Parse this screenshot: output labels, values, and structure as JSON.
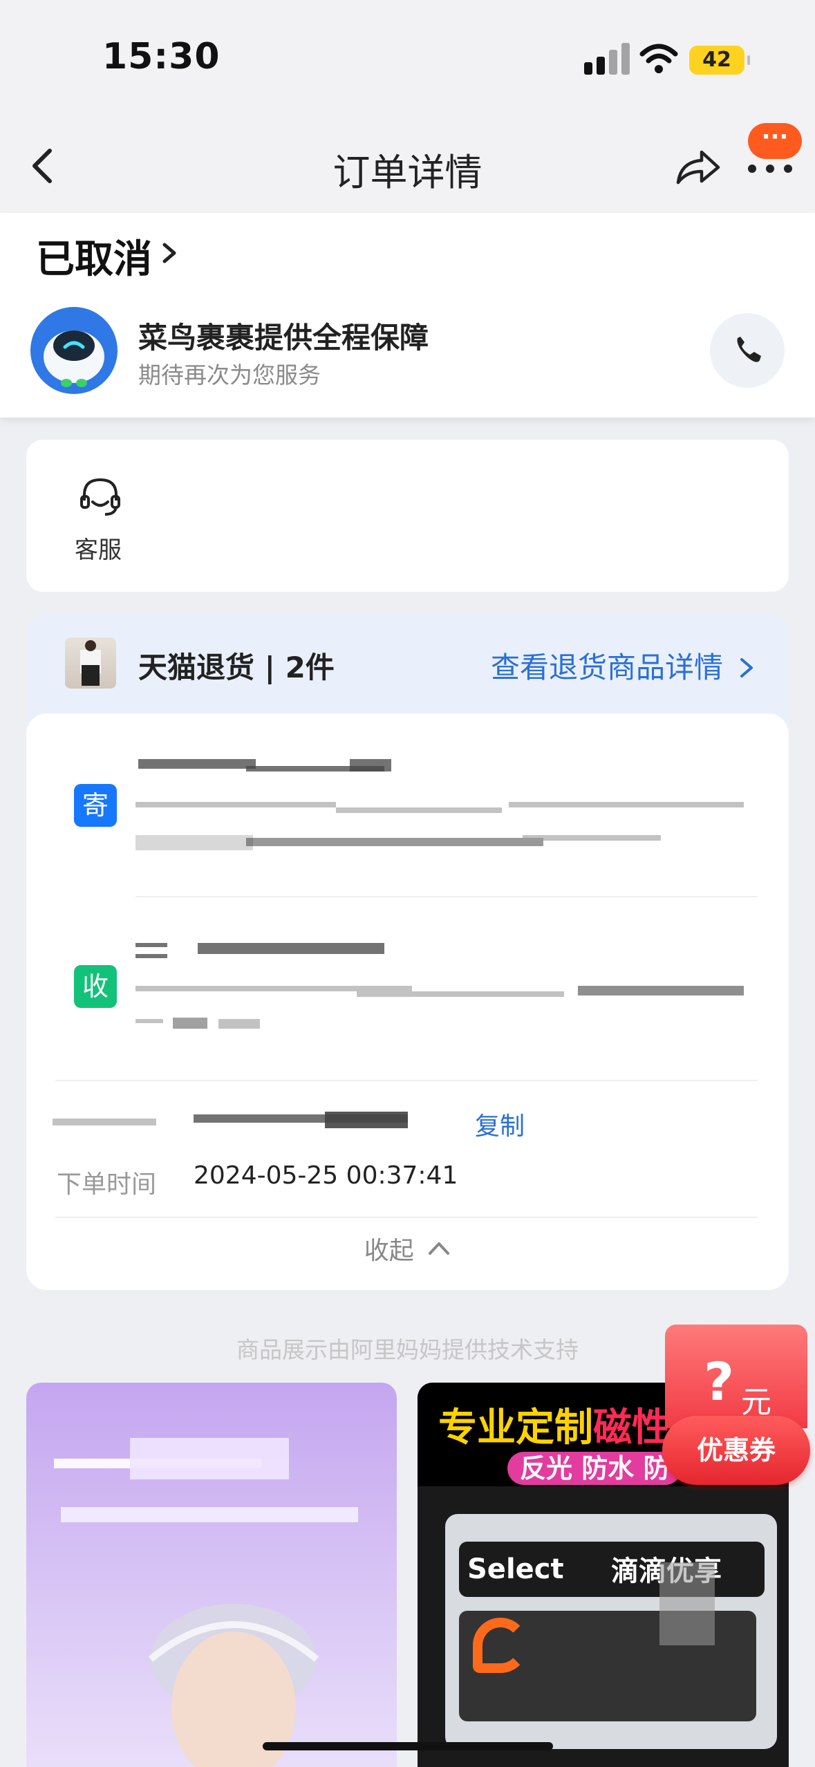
{
  "status_bar": {
    "time": "15:30",
    "battery": "42"
  },
  "nav": {
    "title": "订单详情",
    "badge": "···"
  },
  "order_status": {
    "title": "已取消",
    "courier_title": "菜鸟裹裹提供全程保障",
    "courier_subtitle": "期待再次为您服务"
  },
  "service": {
    "label": "客服"
  },
  "return_section": {
    "title": "天猫退货 | 2件",
    "details_link": "查看退货商品详情",
    "send_tag": "寄",
    "receive_tag": "收",
    "copy_label": "复制",
    "order_time_label": "下单时间",
    "order_time_value": "2024-05-25 00:37:41",
    "collapse_label": "收起"
  },
  "footer_note": "商品展示由阿里妈妈提供技术支持",
  "products": {
    "p2_title_a": "专业定制",
    "p2_title_b": "磁性",
    "p2_tags": "反光 防水 防",
    "p2_plate_text": "Select",
    "p2_brand": "滴滴优享"
  },
  "coupon": {
    "amount": "?",
    "unit": "元",
    "label": "优惠券"
  }
}
